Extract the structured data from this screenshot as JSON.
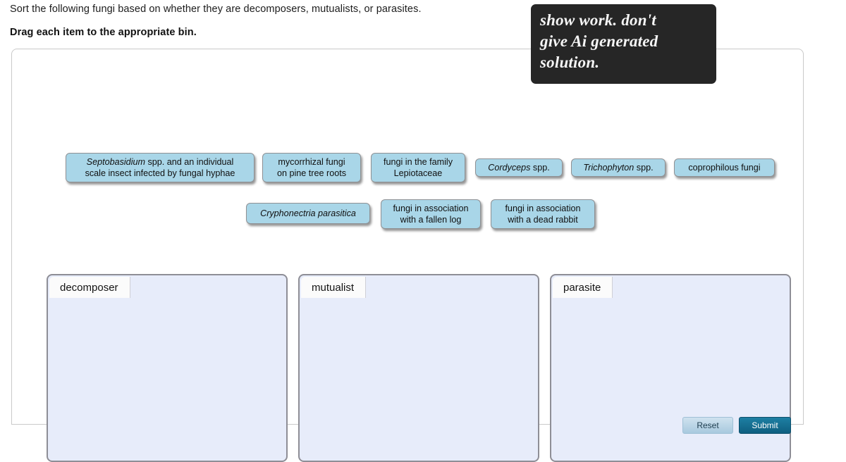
{
  "prompt": {
    "instruction": "Sort the following fungi based on whether they are decomposers, mutualists, or parasites.",
    "directive": "Drag each item to the appropriate bin."
  },
  "note_overlay": {
    "text": "show work. don't\ngive Ai generated\nsolution.",
    "background_color": "#262626",
    "text_color": "#f5f5f5"
  },
  "colors": {
    "tile_fill": "#a9d6e8",
    "tile_border": "#8f9194",
    "bin_fill": "#e7ecfa",
    "bin_border": "#8e8e96",
    "panel_border": "#c9c9c9",
    "submit_accent": "#1d7fa3"
  },
  "tiles": [
    {
      "id": "septobasidium",
      "text_html": "<i>Septobasidium</i> spp. and an individual\nscale insect infected by fungal hyphae",
      "text": "Septobasidium spp. and an individual scale insect infected by fungal hyphae"
    },
    {
      "id": "mycorrhizal",
      "text_html": "mycorrhizal fungi\non pine tree roots",
      "text": "mycorrhizal fungi on pine tree roots"
    },
    {
      "id": "lepiotaceae",
      "text_html": "fungi in the family\nLepiotaceae",
      "text": "fungi in the family Lepiotaceae"
    },
    {
      "id": "cordyceps",
      "text_html": "<i>Cordyceps</i> spp.",
      "text": "Cordyceps spp."
    },
    {
      "id": "trichophyton",
      "text_html": "<i>Trichophyton</i> spp.",
      "text": "Trichophyton spp."
    },
    {
      "id": "coprophilous",
      "text_html": "coprophilous fungi",
      "text": "coprophilous fungi"
    },
    {
      "id": "cryphonectria",
      "text_html": "<i>Cryphonectria parasitica</i>",
      "text": "Cryphonectria parasitica"
    },
    {
      "id": "fallen-log",
      "text_html": "fungi in association\nwith a fallen log",
      "text": "fungi in association with a fallen log"
    },
    {
      "id": "dead-rabbit",
      "text_html": "fungi in association\nwith a dead rabbit",
      "text": "fungi in association with a dead rabbit"
    }
  ],
  "bins": [
    {
      "id": "decomposer",
      "label": "decomposer",
      "items": []
    },
    {
      "id": "mutualist",
      "label": "mutualist",
      "items": []
    },
    {
      "id": "parasite",
      "label": "parasite",
      "items": []
    }
  ],
  "buttons": {
    "reset_label": "Reset",
    "submit_label": "Submit"
  }
}
